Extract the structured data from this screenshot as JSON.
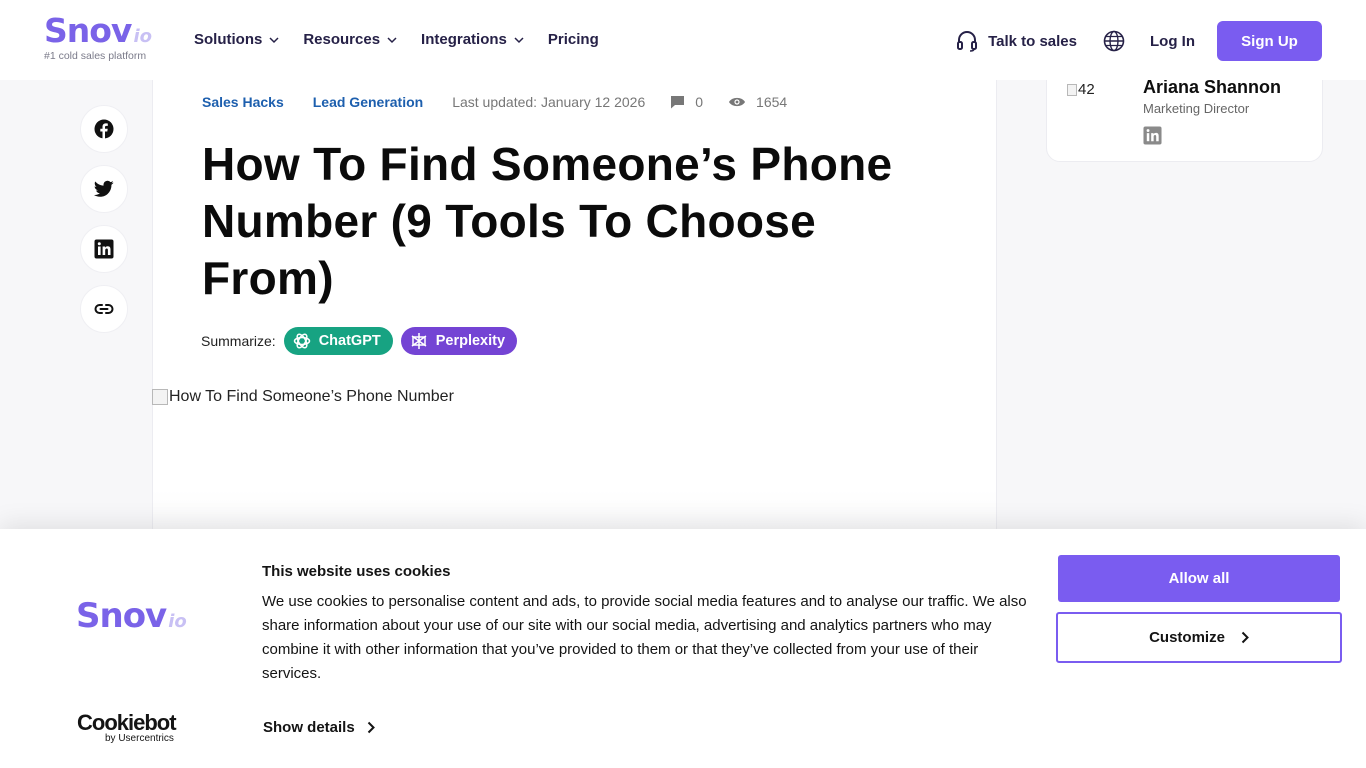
{
  "header": {
    "logo": {
      "main": "Snov",
      "suffix": "io",
      "tagline": "#1 cold sales platform"
    },
    "nav": [
      {
        "label": "Solutions",
        "has_dropdown": true
      },
      {
        "label": "Resources",
        "has_dropdown": true
      },
      {
        "label": "Integrations",
        "has_dropdown": true
      },
      {
        "label": "Pricing",
        "has_dropdown": false
      }
    ],
    "talk_to_sales": "Talk to sales",
    "login": "Log In",
    "signup": "Sign Up"
  },
  "article": {
    "categories": [
      "Sales Hacks",
      "Lead Generation"
    ],
    "updated": "Last updated: January 12 2026",
    "comments": "0",
    "views": "1654",
    "title": "How To Find Someone’s Phone Number (9 Tools To Choose From)",
    "summarize": {
      "label": "Summarize:",
      "chatgpt": "ChatGPT",
      "perplexity": "Perplexity"
    },
    "hero_alt": "How To Find Someone’s Phone Number"
  },
  "share": [
    "facebook-icon",
    "twitter-icon",
    "linkedin-icon",
    "link-icon"
  ],
  "author": {
    "img_alt": "42",
    "name": "Ariana Shannon",
    "role": "Marketing Director"
  },
  "cookie": {
    "logo": {
      "main": "Snov",
      "suffix": "io"
    },
    "title": "This website uses cookies",
    "text": "We use cookies to personalise content and ads, to provide social media features and to analyse our traffic. We also share information about your use of our site with our social media, advertising and analytics partners who may combine it with other information that you’ve provided to them or that they’ve collected from your use of their services.",
    "show_details": "Show details",
    "brand": {
      "main": "Cookiebot",
      "sub": "by Usercentrics"
    },
    "allow_all": "Allow all",
    "customize": "Customize"
  },
  "colors": {
    "accent": "#7a5cf0",
    "category": "#1d5fae",
    "chatgpt": "#17a382",
    "perplexity": "#7444d4"
  }
}
